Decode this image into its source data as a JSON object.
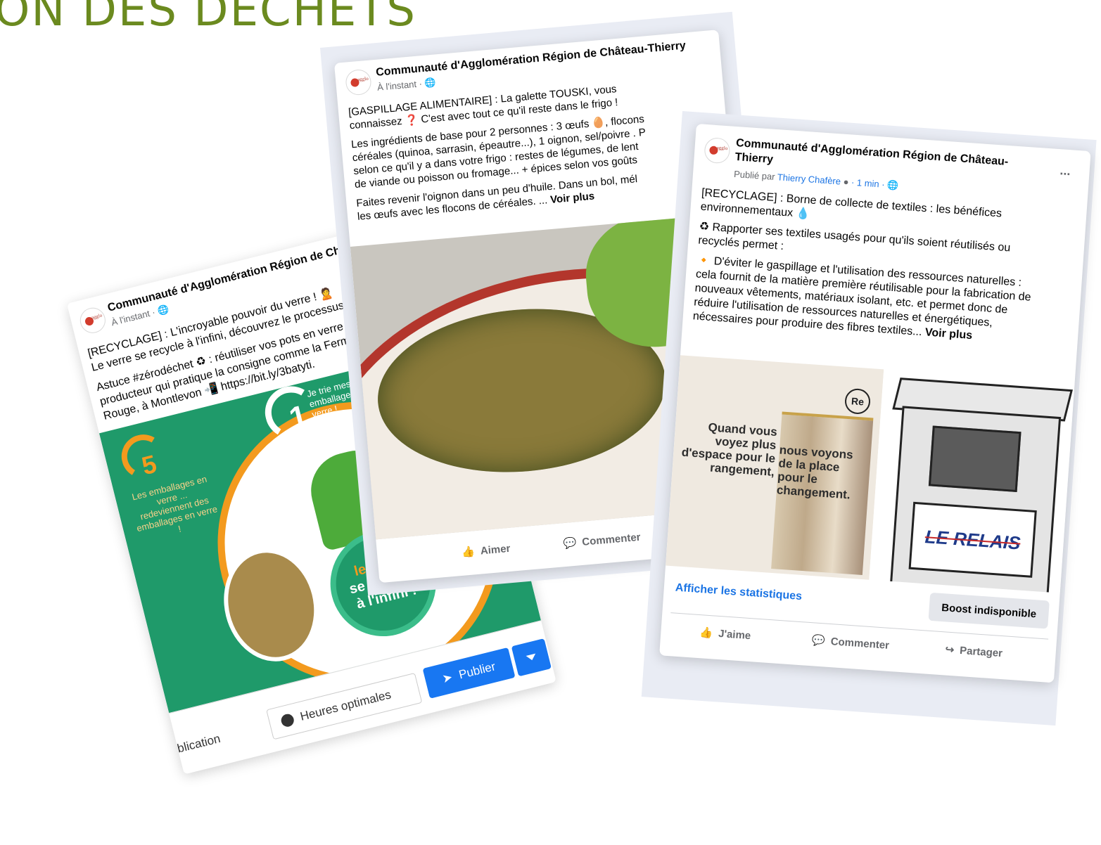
{
  "headline": "ON DES DÉCHETS",
  "colors": {
    "brand_green": "#6b8a1f",
    "fb_blue": "#1877f2",
    "poster_green": "#1f9a6a",
    "poster_orange": "#f39a1e"
  },
  "post_verre": {
    "page_name": "Communauté d'Agglomération Région de Ch",
    "time": "À l'instant · ",
    "text_1": "[RECYCLAGE] : L'incroyable pouvoir du verre ! 🙎",
    "text_2": "Le verre se recycle à l'infini, découvrez le processus",
    "text_3": "Astuce #zérodéchet ♻ : réutiliser vos pots en verre",
    "text_4": "producteur qui pratique la consigne comme la Ferm",
    "text_5": "Rouge, à Montlevon 📲 https://bit.ly/3batyti.",
    "poster": {
      "step_1_number": "1",
      "step_1_text": "Je trie mes emballages en verre !",
      "step_5_number": "5",
      "step_5_text": "Les emballages en verre ... redeviennent des emballages en verre !",
      "center_line_1": "le verre",
      "center_line_2": "se recycle",
      "center_line_3": "à l'infini !"
    },
    "toolbar": {
      "publication_label": "ublication",
      "hours_label": "Heures optimales",
      "publish_label": "Publier",
      "icon_clock": "clock-icon",
      "icon_send": "send-icon"
    }
  },
  "post_galette": {
    "page_name": "Communauté d'Agglomération Région de Château-Thierry",
    "time": "À l'instant · ",
    "text_1": "[GASPILLAGE ALIMENTAIRE] : La galette TOUSKI, vous",
    "text_2": "connaissez ❓ C'est avec tout ce qu'il reste dans le frigo !",
    "text_3": "Les ingrédients de base pour 2 personnes : 3 œufs 🥚, flocons",
    "text_4": "céréales (quinoa, sarrasin, épeautre...), 1 oignon, sel/poivre . P",
    "text_5": "selon ce qu'il y a dans votre frigo : restes de légumes, de lent",
    "text_6": "de viande ou poisson ou fromage... + épices selon vos goûts",
    "text_7": "Faites revenir l'oignon dans un peu d'huile. Dans un bol, mél",
    "text_8": "les œufs avec les flocons de céréales. ...",
    "see_more": "Voir plus",
    "like_label": "Aimer",
    "comment_label": "Commenter"
  },
  "post_relais": {
    "page_name_1": "Communauté d'Agglomération Région de Château-",
    "page_name_2": "Thierry",
    "published_by": "Publié par ",
    "author": "Thierry Chafère",
    "time": " · 1 min · ",
    "more": "...",
    "text_1": "[RECYCLAGE] : Borne de collecte de textiles : les bénéfices",
    "text_2": "environnementaux 💧",
    "text_3": "♻ Rapporter ses textiles usagés pour qu'ils soient réutilisés ou",
    "text_4": "recyclés permet  :",
    "text_5": "🔸 D'éviter le gaspillage et l'utilisation des ressources naturelles :",
    "text_6": "cela fournit de la matière première réutilisable pour la fabrication de",
    "text_7": "nouveaux vêtements, matériaux isolant, etc.  et permet donc de",
    "text_8": "réduire l'utilisation de ressources naturelles et énergétiques,",
    "text_9": "nécessaires pour produire des fibres textiles...",
    "see_more": "Voir plus",
    "image_text_left": "Quand vous voyez plus d'espace pour le rangement,",
    "image_text_right": "nous voyons de la place pour le changement.",
    "re_logo": "Re",
    "bin_label": "LE RELAIS",
    "stats_link": "Afficher les statistiques",
    "boost_label": "Boost indisponible",
    "like_label": "J'aime",
    "comment_label": "Commenter",
    "share_label": "Partager"
  }
}
